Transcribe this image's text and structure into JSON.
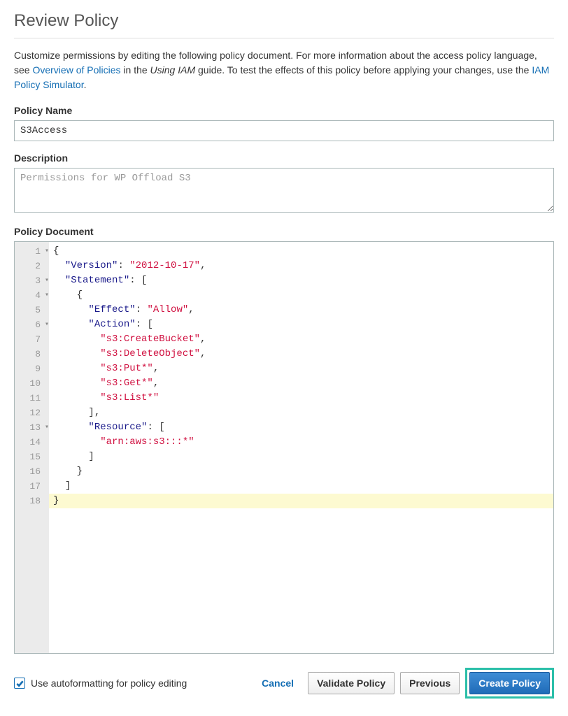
{
  "header": {
    "title": "Review Policy"
  },
  "intro": {
    "text1": "Customize permissions by editing the following policy document. For more information about the access policy language, see ",
    "link1": "Overview of Policies",
    "text2": " in the ",
    "italic": "Using IAM",
    "text3": " guide. To test the effects of this policy before applying your changes, use the ",
    "link2": "IAM Policy Simulator",
    "text4": "."
  },
  "fields": {
    "name_label": "Policy Name",
    "name_value": "S3Access",
    "desc_label": "Description",
    "desc_value": "Permissions for WP Offload S3",
    "doc_label": "Policy Document"
  },
  "code": {
    "lines": [
      {
        "n": 1,
        "fold": true,
        "indent": 0,
        "tokens": [
          {
            "t": "{",
            "c": "p"
          }
        ]
      },
      {
        "n": 2,
        "fold": false,
        "indent": 1,
        "tokens": [
          {
            "t": "\"Version\"",
            "c": "kw"
          },
          {
            "t": ": ",
            "c": "p"
          },
          {
            "t": "\"2012-10-17\"",
            "c": "str"
          },
          {
            "t": ",",
            "c": "p"
          }
        ]
      },
      {
        "n": 3,
        "fold": true,
        "indent": 1,
        "tokens": [
          {
            "t": "\"Statement\"",
            "c": "kw"
          },
          {
            "t": ": [",
            "c": "p"
          }
        ]
      },
      {
        "n": 4,
        "fold": true,
        "indent": 2,
        "tokens": [
          {
            "t": "{",
            "c": "p"
          }
        ]
      },
      {
        "n": 5,
        "fold": false,
        "indent": 3,
        "tokens": [
          {
            "t": "\"Effect\"",
            "c": "kw"
          },
          {
            "t": ": ",
            "c": "p"
          },
          {
            "t": "\"Allow\"",
            "c": "str"
          },
          {
            "t": ",",
            "c": "p"
          }
        ]
      },
      {
        "n": 6,
        "fold": true,
        "indent": 3,
        "tokens": [
          {
            "t": "\"Action\"",
            "c": "kw"
          },
          {
            "t": ": [",
            "c": "p"
          }
        ]
      },
      {
        "n": 7,
        "fold": false,
        "indent": 4,
        "tokens": [
          {
            "t": "\"s3:CreateBucket\"",
            "c": "str"
          },
          {
            "t": ",",
            "c": "p"
          }
        ]
      },
      {
        "n": 8,
        "fold": false,
        "indent": 4,
        "tokens": [
          {
            "t": "\"s3:DeleteObject\"",
            "c": "str"
          },
          {
            "t": ",",
            "c": "p"
          }
        ]
      },
      {
        "n": 9,
        "fold": false,
        "indent": 4,
        "tokens": [
          {
            "t": "\"s3:Put*\"",
            "c": "str"
          },
          {
            "t": ",",
            "c": "p"
          }
        ]
      },
      {
        "n": 10,
        "fold": false,
        "indent": 4,
        "tokens": [
          {
            "t": "\"s3:Get*\"",
            "c": "str"
          },
          {
            "t": ",",
            "c": "p"
          }
        ]
      },
      {
        "n": 11,
        "fold": false,
        "indent": 4,
        "tokens": [
          {
            "t": "\"s3:List*\"",
            "c": "str"
          }
        ]
      },
      {
        "n": 12,
        "fold": false,
        "indent": 3,
        "tokens": [
          {
            "t": "],",
            "c": "p"
          }
        ]
      },
      {
        "n": 13,
        "fold": true,
        "indent": 3,
        "tokens": [
          {
            "t": "\"Resource\"",
            "c": "kw"
          },
          {
            "t": ": [",
            "c": "p"
          }
        ]
      },
      {
        "n": 14,
        "fold": false,
        "indent": 4,
        "tokens": [
          {
            "t": "\"arn:aws:s3:::*\"",
            "c": "str"
          }
        ]
      },
      {
        "n": 15,
        "fold": false,
        "indent": 3,
        "tokens": [
          {
            "t": "]",
            "c": "p"
          }
        ]
      },
      {
        "n": 16,
        "fold": false,
        "indent": 2,
        "tokens": [
          {
            "t": "}",
            "c": "p"
          }
        ]
      },
      {
        "n": 17,
        "fold": false,
        "indent": 1,
        "tokens": [
          {
            "t": "]",
            "c": "p"
          }
        ]
      },
      {
        "n": 18,
        "fold": false,
        "indent": 0,
        "tokens": [
          {
            "t": "}",
            "c": "p"
          }
        ],
        "current": true
      }
    ]
  },
  "footer": {
    "autoformat_label": "Use autoformatting for policy editing",
    "autoformat_checked": true,
    "buttons": {
      "cancel": "Cancel",
      "validate": "Validate Policy",
      "previous": "Previous",
      "create": "Create Policy"
    }
  }
}
